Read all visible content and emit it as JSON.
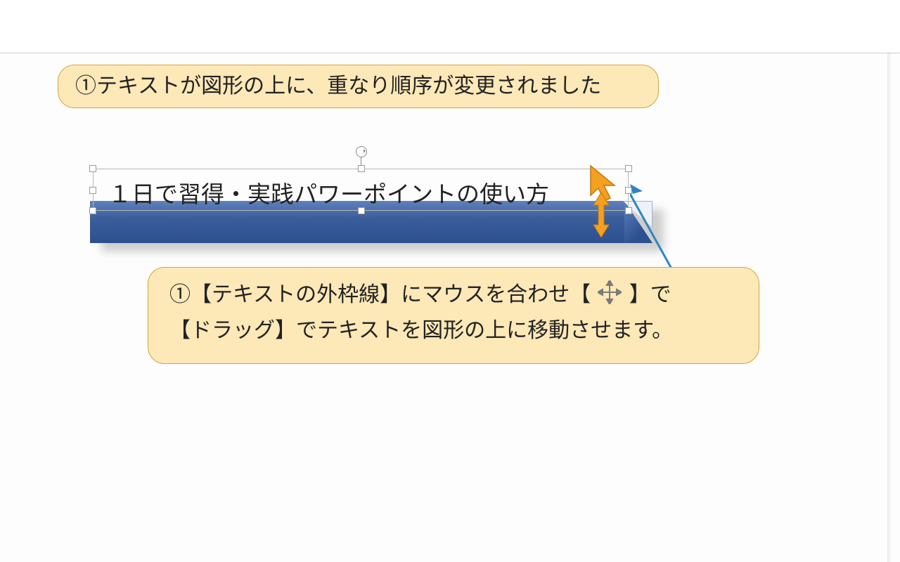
{
  "callout1": {
    "text": "①テキストが図形の上に、重なり順序が変更されました"
  },
  "callout2": {
    "line1_a": "①【テキストの外枠線】にマウスを合わせ【",
    "line1_b": "】で",
    "line2": "【ドラッグ】でテキストを図形の上に移動させます。"
  },
  "textbox": {
    "content": "１日で習得・実践パワーポイントの使い方"
  }
}
